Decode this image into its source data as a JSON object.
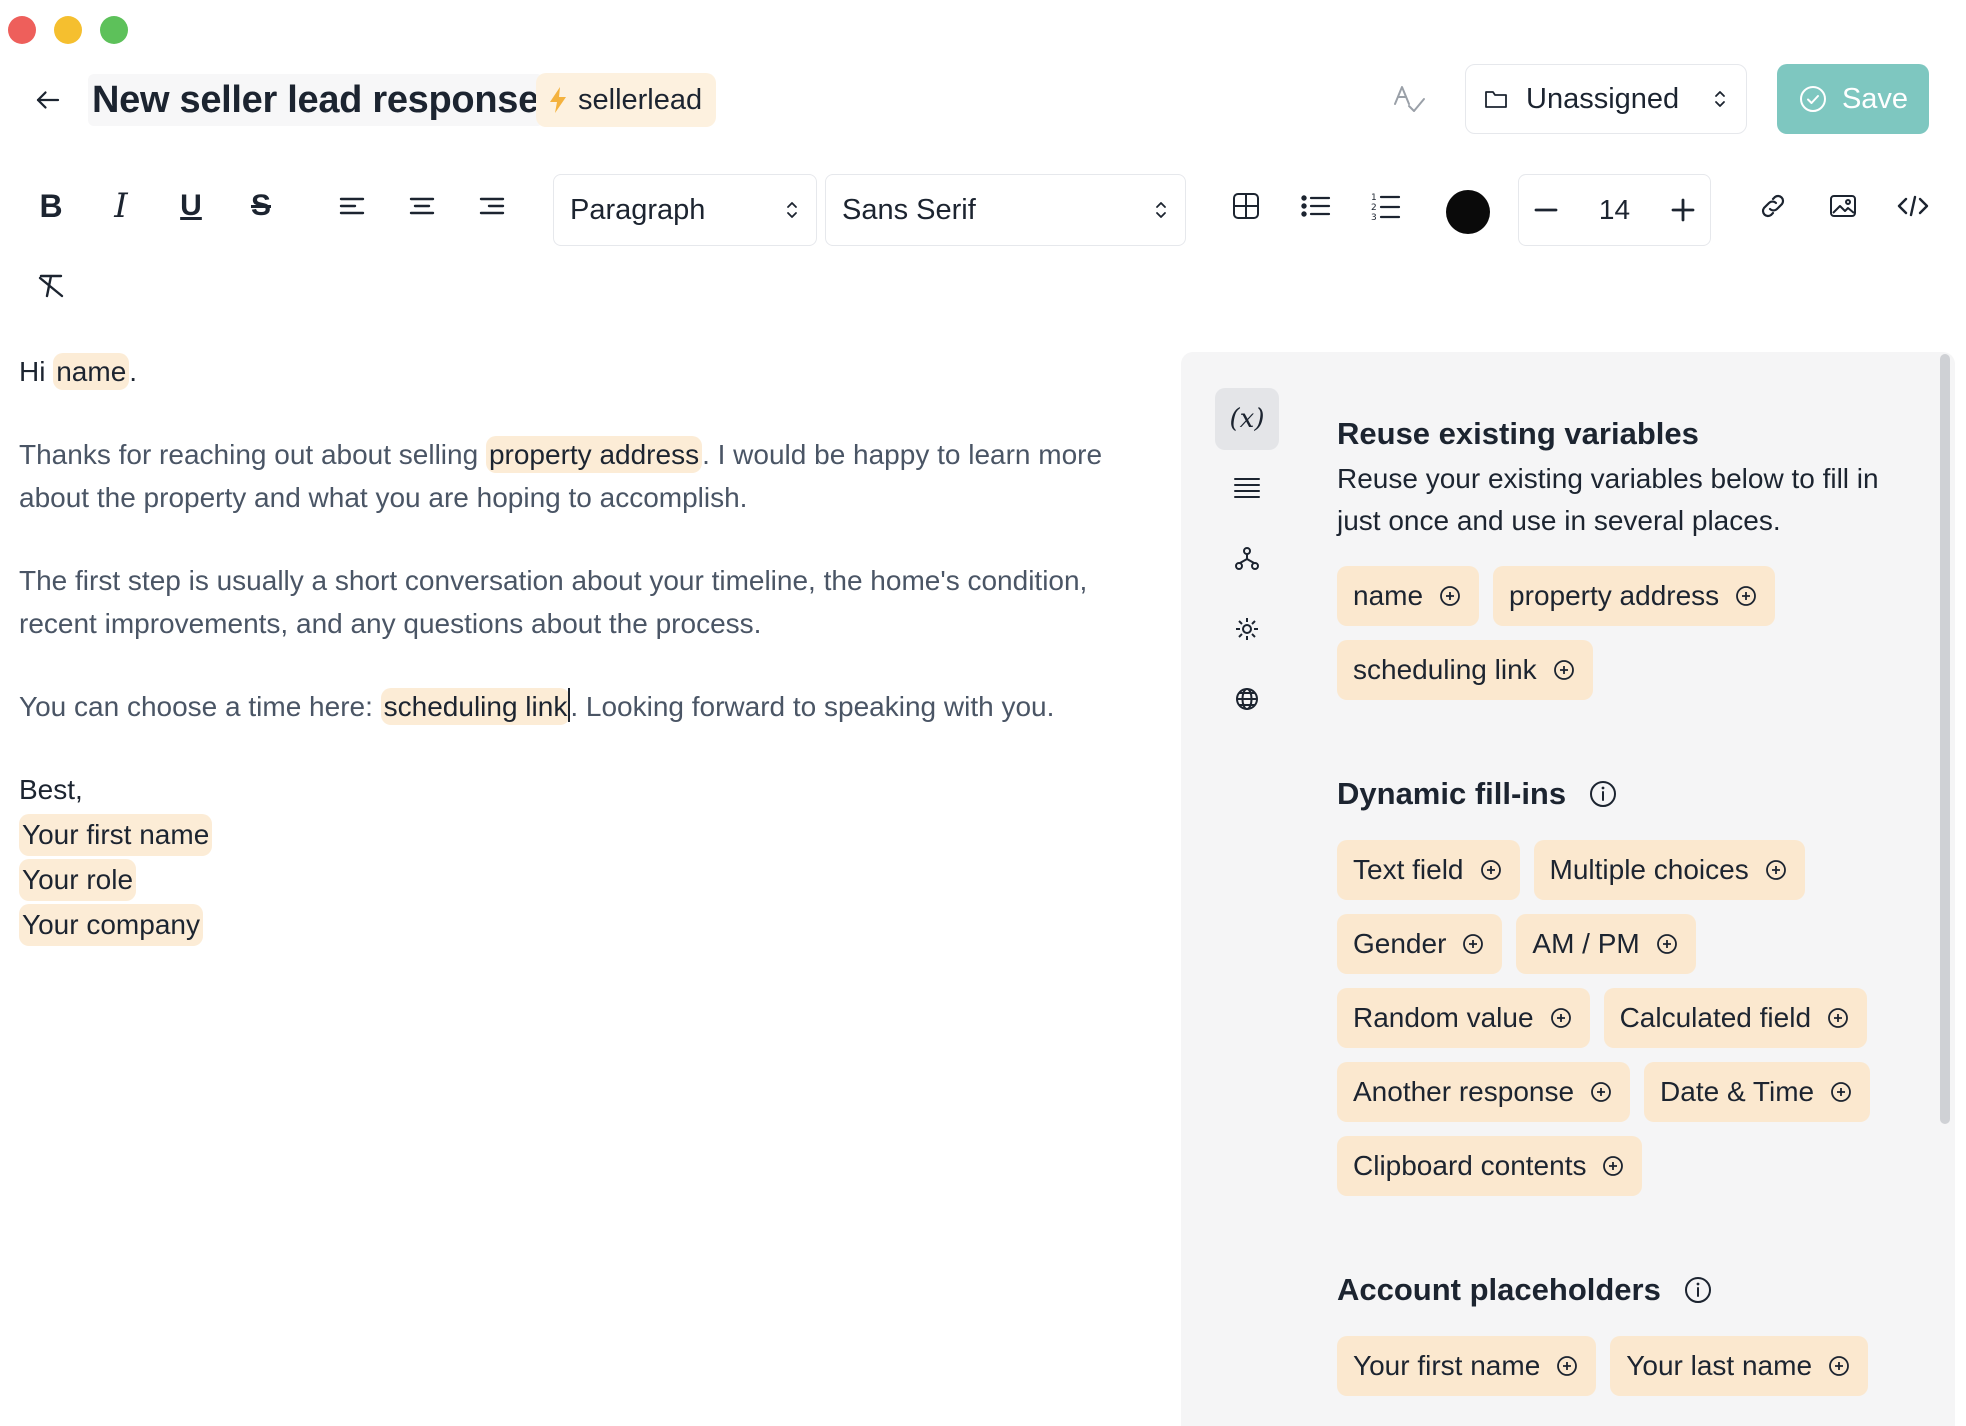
{
  "window": {
    "controls": [
      "close",
      "minimize",
      "maximize"
    ]
  },
  "header": {
    "title": "New seller lead response",
    "shortcut": "sellerlead",
    "folder_label": "Unassigned",
    "save_label": "Save"
  },
  "toolbar": {
    "block_style": "Paragraph",
    "font_family": "Sans Serif",
    "font_size": "14",
    "text_color": "#000000"
  },
  "editor": {
    "greeting_prefix": "Hi ",
    "greeting_var": "name",
    "greeting_suffix": ".",
    "p1_prefix": "Thanks for reaching out about selling ",
    "p1_var": "property address",
    "p1_suffix": ". I would be happy to learn more about the property and what you are hoping to accomplish.",
    "p2": "The first step is usually a short conversation about your timeline, the home's condition, recent improvements, and any questions about the process.",
    "p3_prefix": "You can choose a time here: ",
    "p3_var": "scheduling link",
    "p3_suffix": ". Looking forward to speaking with you.",
    "signoff": "Best,",
    "sig_first_name": "Your first name",
    "sig_role": "Your role",
    "sig_company": "Your company"
  },
  "panel": {
    "rail_icons": [
      "variable-icon",
      "list-icon",
      "hierarchy-icon",
      "gear-icon",
      "globe-icon"
    ],
    "reuse": {
      "title": "Reuse existing variables",
      "description": "Reuse your existing variables below to fill in just once and use in several places.",
      "chips": [
        "name",
        "property address",
        "scheduling link"
      ]
    },
    "dynamic": {
      "title": "Dynamic fill-ins",
      "chips": [
        "Text field",
        "Multiple choices",
        "Gender",
        "AM / PM",
        "Random value",
        "Calculated field",
        "Another response",
        "Date & Time",
        "Clipboard contents"
      ]
    },
    "account": {
      "title": "Account placeholders",
      "chips": [
        "Your first name",
        "Your last name"
      ]
    }
  },
  "colors": {
    "accent_save": "#7ec7c0",
    "chip_bg": "#fbe8cf",
    "panel_bg": "#f5f5f6"
  }
}
